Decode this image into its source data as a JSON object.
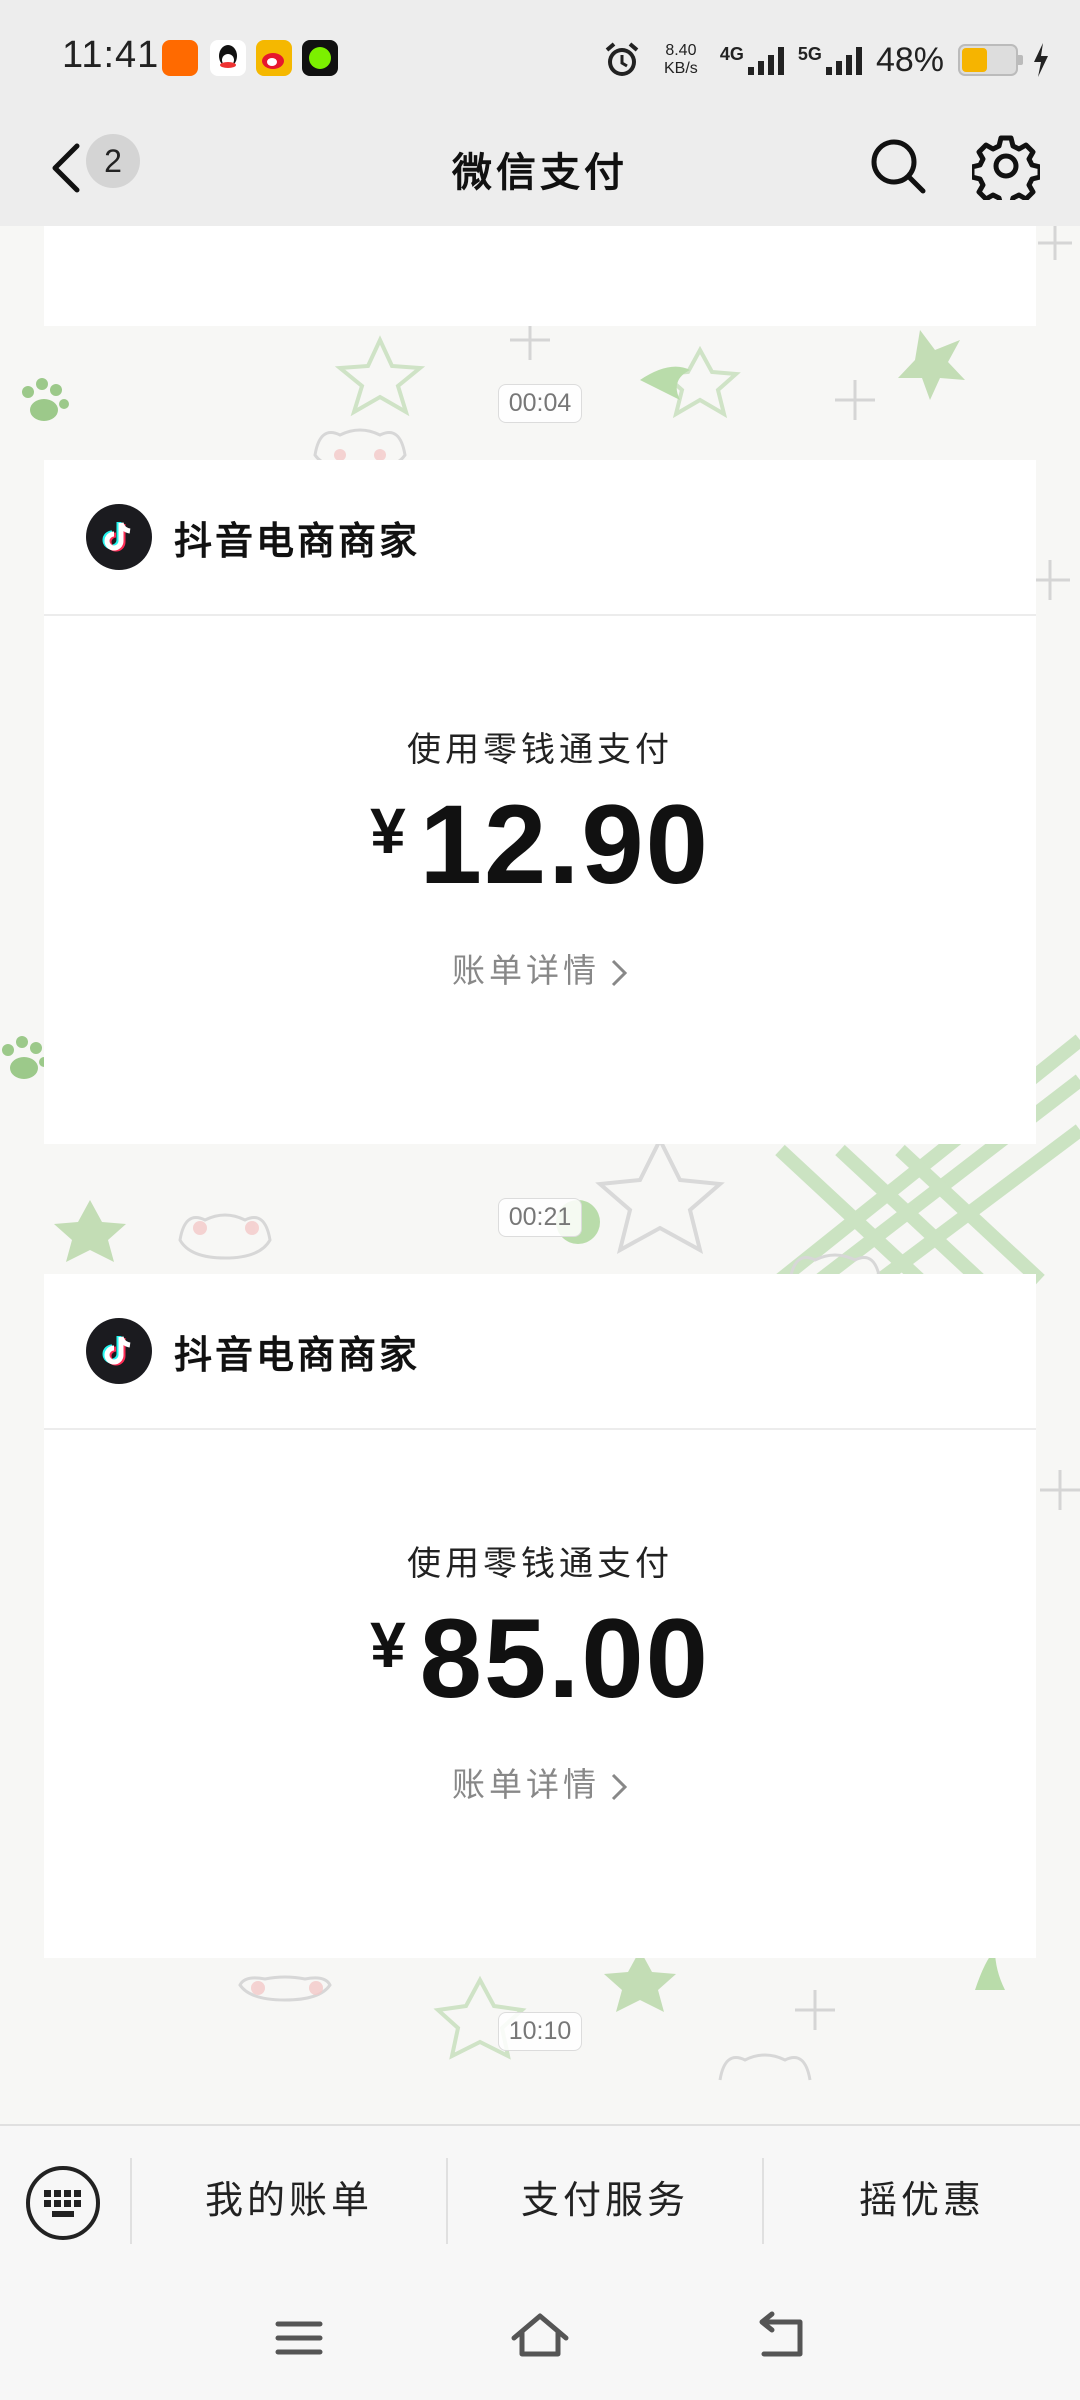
{
  "status_bar": {
    "time": "11:41",
    "apps": [
      {
        "icon": "taobao-icon",
        "color": "#ff6a00"
      },
      {
        "icon": "qq-icon",
        "color": "#ffffff"
      },
      {
        "icon": "weibo-icon",
        "color": "#f5b800"
      },
      {
        "icon": "green-dot-app-icon",
        "color": "#111111"
      }
    ],
    "net_speed_value": "8.40",
    "net_speed_unit": "KB/s",
    "net_4g": "4G",
    "net_5g": "5G",
    "battery_percent": "48%",
    "battery_level": 0.48,
    "battery_color": "#f6b400"
  },
  "header": {
    "unread_count": "2",
    "title": "微信支付"
  },
  "messages": [
    {
      "time": "00:04",
      "merchant": "抖音电商商家",
      "pay_method": "使用零钱通支付",
      "currency": "¥",
      "amount": "12.90",
      "detail_link": "账单详情"
    },
    {
      "time": "00:21",
      "merchant": "抖音电商商家",
      "pay_method": "使用零钱通支付",
      "currency": "¥",
      "amount": "85.00",
      "detail_link": "账单详情"
    }
  ],
  "last_time": "10:10",
  "bottom_menu": {
    "items": [
      "我的账单",
      "支付服务",
      "摇优惠"
    ]
  },
  "colors": {
    "header_bg": "#ededed",
    "card_bg": "#ffffff",
    "decor_green": "#9cc98a"
  }
}
